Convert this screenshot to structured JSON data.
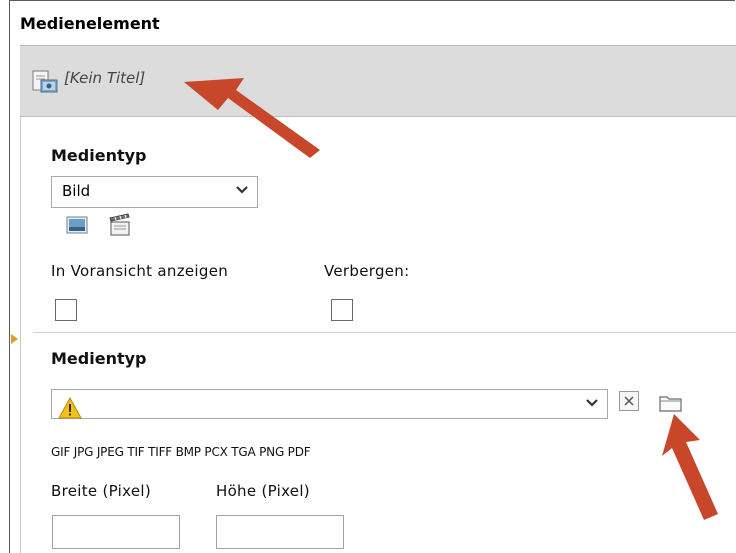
{
  "section_title": "Medienelement",
  "record": {
    "title": "[Kein Titel]"
  },
  "media_type": {
    "label": "Medientyp",
    "value": "Bild",
    "type_icons": [
      "image-icon",
      "video-clapper-icon"
    ]
  },
  "options": {
    "preview_label": "In Voransicht anzeigen",
    "hide_label": "Verbergen:"
  },
  "file": {
    "label": "Medientyp",
    "value": "",
    "allowed_types": "GIF JPG JPEG TIF TIFF BMP PCX TGA PNG PDF"
  },
  "dimensions": {
    "width_label": "Breite (Pixel)",
    "height_label": "Höhe (Pixel)",
    "width_value": "",
    "height_value": ""
  },
  "colors": {
    "arrow": "#c8462a",
    "header_bg": "#dcdcdc",
    "marker": "#e09a2e",
    "warning": "#f2c21b"
  }
}
